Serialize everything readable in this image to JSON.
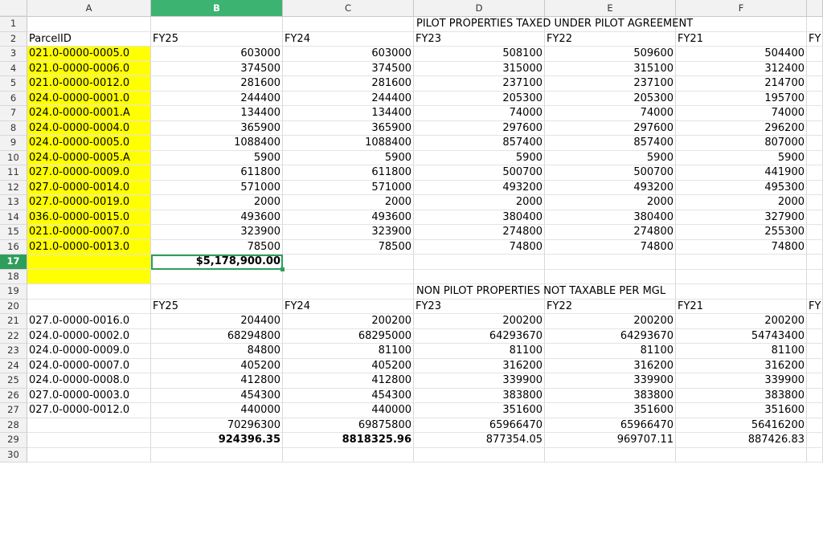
{
  "columns": [
    "A",
    "B",
    "C",
    "D",
    "E",
    "F"
  ],
  "row_numbers": [
    "1",
    "2",
    "3",
    "4",
    "5",
    "6",
    "7",
    "8",
    "9",
    "10",
    "11",
    "12",
    "13",
    "14",
    "15",
    "16",
    "17",
    "18",
    "19",
    "20",
    "21",
    "22",
    "23",
    "24",
    "25",
    "26",
    "27",
    "28",
    "29",
    "30"
  ],
  "section1": {
    "title": "PILOT PROPERTIES TAXED UNDER PILOT AGREEMENT",
    "headers": [
      "ParcelID",
      "FY25",
      "FY24",
      "FY23",
      "FY22",
      "FY21",
      "FY"
    ],
    "rows": [
      [
        "021.0-0000-0005.0",
        "603000",
        "603000",
        "508100",
        "509600",
        "504400"
      ],
      [
        "021.0-0000-0006.0",
        "374500",
        "374500",
        "315000",
        "315100",
        "312400"
      ],
      [
        "021.0-0000-0012.0",
        "281600",
        "281600",
        "237100",
        "237100",
        "214700"
      ],
      [
        "024.0-0000-0001.0",
        "244400",
        "244400",
        "205300",
        "205300",
        "195700"
      ],
      [
        "024.0-0000-0001.A",
        "134400",
        "134400",
        "74000",
        "74000",
        "74000"
      ],
      [
        "024.0-0000-0004.0",
        "365900",
        "365900",
        "297600",
        "297600",
        "296200"
      ],
      [
        "024.0-0000-0005.0",
        "1088400",
        "1088400",
        "857400",
        "857400",
        "807000"
      ],
      [
        "024.0-0000-0005.A",
        "5900",
        "5900",
        "5900",
        "5900",
        "5900"
      ],
      [
        "027.0-0000-0009.0",
        "611800",
        "611800",
        "500700",
        "500700",
        "441900"
      ],
      [
        "027.0-0000-0014.0",
        "571000",
        "571000",
        "493200",
        "493200",
        "495300"
      ],
      [
        "027.0-0000-0019.0",
        "2000",
        "2000",
        "2000",
        "2000",
        "2000"
      ],
      [
        "036.0-0000-0015.0",
        "493600",
        "493600",
        "380400",
        "380400",
        "327900"
      ],
      [
        "021.0-0000-0007.0",
        "323900",
        "323900",
        "274800",
        "274800",
        "255300"
      ],
      [
        "021.0-0000-0013.0",
        "78500",
        "78500",
        "74800",
        "74800",
        "74800"
      ]
    ],
    "total_b": "$5,178,900.00"
  },
  "section2": {
    "title": "NON PILOT PROPERTIES NOT TAXABLE PER MGL",
    "headers": [
      "",
      "FY25",
      "FY24",
      "FY23",
      "FY22",
      "FY21",
      "FY"
    ],
    "rows": [
      [
        "027.0-0000-0016.0",
        "204400",
        "200200",
        "200200",
        "200200",
        "200200"
      ],
      [
        "024.0-0000-0002.0",
        "68294800",
        "68295000",
        "64293670",
        "64293670",
        "54743400"
      ],
      [
        "024.0-0000-0009.0",
        "84800",
        "81100",
        "81100",
        "81100",
        "81100"
      ],
      [
        "024.0-0000-0007.0",
        "405200",
        "405200",
        "316200",
        "316200",
        "316200"
      ],
      [
        "024.0-0000-0008.0",
        "412800",
        "412800",
        "339900",
        "339900",
        "339900"
      ],
      [
        "027.0-0000-0003.0",
        "454300",
        "454300",
        "383800",
        "383800",
        "383800"
      ],
      [
        "027.0-0000-0012.0",
        "440000",
        "440000",
        "351600",
        "351600",
        "351600"
      ]
    ],
    "totals": [
      "",
      "70296300",
      "69875800",
      "65966470",
      "65966470",
      "56416200"
    ],
    "taxes": [
      "",
      "924396.35",
      "8818325.96",
      "877354.05",
      "969707.11",
      "887426.83"
    ]
  }
}
